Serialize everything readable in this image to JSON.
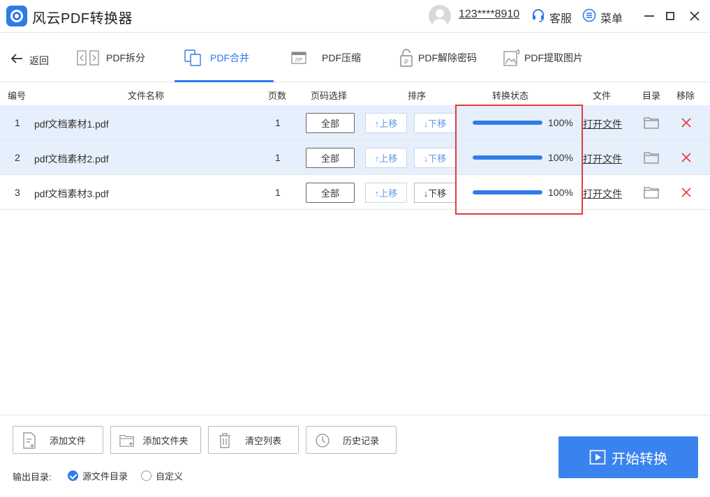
{
  "titlebar": {
    "app_title": "风云PDF转换器",
    "user_name": "123****8910",
    "service_label": "客服",
    "menu_label": "菜单"
  },
  "nav": {
    "back_label": "返回",
    "tabs": [
      {
        "label": "PDF拆分",
        "icon": "split-icon",
        "active": false
      },
      {
        "label": "PDF合并",
        "icon": "merge-icon",
        "active": true
      },
      {
        "label": "PDF压缩",
        "icon": "zip-icon",
        "active": false
      },
      {
        "label": "PDF解除密码",
        "icon": "unlock-icon",
        "active": false
      },
      {
        "label": "PDF提取图片",
        "icon": "image-icon",
        "active": false
      }
    ]
  },
  "table": {
    "headers": {
      "num": "编号",
      "name": "文件名称",
      "pages": "页数",
      "page_select": "页码选择",
      "order": "排序",
      "status": "转换状态",
      "file": "文件",
      "dir": "目录",
      "remove": "移除"
    },
    "rows": [
      {
        "num": "1",
        "name": "pdf文档素材1.pdf",
        "pages": "1",
        "page_select": "全部",
        "up": "↑上移",
        "down": "↓下移",
        "progress": 100,
        "progress_text": "100%",
        "open": "打开文件"
      },
      {
        "num": "2",
        "name": "pdf文档素材2.pdf",
        "pages": "1",
        "page_select": "全部",
        "up": "↑上移",
        "down": "↓下移",
        "progress": 100,
        "progress_text": "100%",
        "open": "打开文件"
      },
      {
        "num": "3",
        "name": "pdf文档素材3.pdf",
        "pages": "1",
        "page_select": "全部",
        "up": "↑上移",
        "down": "↓下移",
        "progress": 100,
        "progress_text": "100%",
        "open": "打开文件"
      }
    ]
  },
  "actions": {
    "add_file": "添加文件",
    "add_folder": "添加文件夹",
    "clear_list": "清空列表",
    "history": "历史记录"
  },
  "output": {
    "label": "输出目录:",
    "option_source": "源文件目录",
    "option_custom": "自定义",
    "selected": "source"
  },
  "start_label": "开始转换",
  "colors": {
    "accent": "#2f7be8",
    "highlight": "#e43a3a",
    "selected_row": "#e6effc"
  }
}
